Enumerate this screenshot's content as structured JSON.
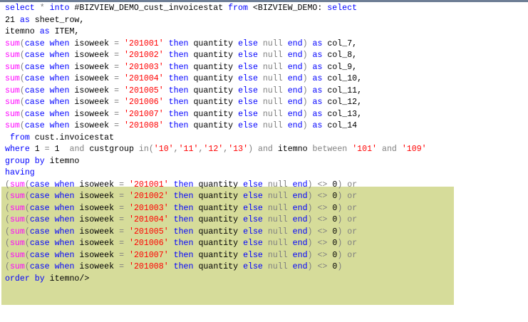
{
  "editor": {
    "lines": [
      [
        [
          "kw",
          "select"
        ],
        [
          "op",
          " * "
        ],
        [
          "kw",
          "into"
        ],
        [
          "plain",
          " #BIZVIEW_DEMO_cust_invoicestat "
        ],
        [
          "kw",
          "from"
        ],
        [
          "plain",
          " <BIZVIEW_DEMO: "
        ],
        [
          "kw",
          "select"
        ]
      ],
      [
        [
          "plain",
          "21 "
        ],
        [
          "kw",
          "as"
        ],
        [
          "plain",
          " sheet_row,"
        ]
      ],
      [
        [
          "plain",
          "itemno "
        ],
        [
          "kw",
          "as"
        ],
        [
          "plain",
          " ITEM,"
        ]
      ],
      [
        [
          "fn",
          "sum"
        ],
        [
          "op",
          "("
        ],
        [
          "kw",
          "case when"
        ],
        [
          "plain",
          " isoweek "
        ],
        [
          "op",
          "="
        ],
        [
          "plain",
          " "
        ],
        [
          "str",
          "'201001'"
        ],
        [
          "plain",
          " "
        ],
        [
          "kw",
          "then"
        ],
        [
          "plain",
          " quantity "
        ],
        [
          "kw",
          "else"
        ],
        [
          "op",
          " null "
        ],
        [
          "kw",
          "end"
        ],
        [
          "op",
          ")"
        ],
        [
          "plain",
          " "
        ],
        [
          "kw",
          "as"
        ],
        [
          "plain",
          " col_7,"
        ]
      ],
      [
        [
          "fn",
          "sum"
        ],
        [
          "op",
          "("
        ],
        [
          "kw",
          "case when"
        ],
        [
          "plain",
          " isoweek "
        ],
        [
          "op",
          "="
        ],
        [
          "plain",
          " "
        ],
        [
          "str",
          "'201002'"
        ],
        [
          "plain",
          " "
        ],
        [
          "kw",
          "then"
        ],
        [
          "plain",
          " quantity "
        ],
        [
          "kw",
          "else"
        ],
        [
          "op",
          " null "
        ],
        [
          "kw",
          "end"
        ],
        [
          "op",
          ")"
        ],
        [
          "plain",
          " "
        ],
        [
          "kw",
          "as"
        ],
        [
          "plain",
          " col_8,"
        ]
      ],
      [
        [
          "fn",
          "sum"
        ],
        [
          "op",
          "("
        ],
        [
          "kw",
          "case when"
        ],
        [
          "plain",
          " isoweek "
        ],
        [
          "op",
          "="
        ],
        [
          "plain",
          " "
        ],
        [
          "str",
          "'201003'"
        ],
        [
          "plain",
          " "
        ],
        [
          "kw",
          "then"
        ],
        [
          "plain",
          " quantity "
        ],
        [
          "kw",
          "else"
        ],
        [
          "op",
          " null "
        ],
        [
          "kw",
          "end"
        ],
        [
          "op",
          ")"
        ],
        [
          "plain",
          " "
        ],
        [
          "kw",
          "as"
        ],
        [
          "plain",
          " col_9,"
        ]
      ],
      [
        [
          "fn",
          "sum"
        ],
        [
          "op",
          "("
        ],
        [
          "kw",
          "case when"
        ],
        [
          "plain",
          " isoweek "
        ],
        [
          "op",
          "="
        ],
        [
          "plain",
          " "
        ],
        [
          "str",
          "'201004'"
        ],
        [
          "plain",
          " "
        ],
        [
          "kw",
          "then"
        ],
        [
          "plain",
          " quantity "
        ],
        [
          "kw",
          "else"
        ],
        [
          "op",
          " null "
        ],
        [
          "kw",
          "end"
        ],
        [
          "op",
          ")"
        ],
        [
          "plain",
          " "
        ],
        [
          "kw",
          "as"
        ],
        [
          "plain",
          " col_10,"
        ]
      ],
      [
        [
          "fn",
          "sum"
        ],
        [
          "op",
          "("
        ],
        [
          "kw",
          "case when"
        ],
        [
          "plain",
          " isoweek "
        ],
        [
          "op",
          "="
        ],
        [
          "plain",
          " "
        ],
        [
          "str",
          "'201005'"
        ],
        [
          "plain",
          " "
        ],
        [
          "kw",
          "then"
        ],
        [
          "plain",
          " quantity "
        ],
        [
          "kw",
          "else"
        ],
        [
          "op",
          " null "
        ],
        [
          "kw",
          "end"
        ],
        [
          "op",
          ")"
        ],
        [
          "plain",
          " "
        ],
        [
          "kw",
          "as"
        ],
        [
          "plain",
          " col_11,"
        ]
      ],
      [
        [
          "fn",
          "sum"
        ],
        [
          "op",
          "("
        ],
        [
          "kw",
          "case when"
        ],
        [
          "plain",
          " isoweek "
        ],
        [
          "op",
          "="
        ],
        [
          "plain",
          " "
        ],
        [
          "str",
          "'201006'"
        ],
        [
          "plain",
          " "
        ],
        [
          "kw",
          "then"
        ],
        [
          "plain",
          " quantity "
        ],
        [
          "kw",
          "else"
        ],
        [
          "op",
          " null "
        ],
        [
          "kw",
          "end"
        ],
        [
          "op",
          ")"
        ],
        [
          "plain",
          " "
        ],
        [
          "kw",
          "as"
        ],
        [
          "plain",
          " col_12,"
        ]
      ],
      [
        [
          "fn",
          "sum"
        ],
        [
          "op",
          "("
        ],
        [
          "kw",
          "case when"
        ],
        [
          "plain",
          " isoweek "
        ],
        [
          "op",
          "="
        ],
        [
          "plain",
          " "
        ],
        [
          "str",
          "'201007'"
        ],
        [
          "plain",
          " "
        ],
        [
          "kw",
          "then"
        ],
        [
          "plain",
          " quantity "
        ],
        [
          "kw",
          "else"
        ],
        [
          "op",
          " null "
        ],
        [
          "kw",
          "end"
        ],
        [
          "op",
          ")"
        ],
        [
          "plain",
          " "
        ],
        [
          "kw",
          "as"
        ],
        [
          "plain",
          " col_13,"
        ]
      ],
      [
        [
          "fn",
          "sum"
        ],
        [
          "op",
          "("
        ],
        [
          "kw",
          "case when"
        ],
        [
          "plain",
          " isoweek "
        ],
        [
          "op",
          "="
        ],
        [
          "plain",
          " "
        ],
        [
          "str",
          "'201008'"
        ],
        [
          "plain",
          " "
        ],
        [
          "kw",
          "then"
        ],
        [
          "plain",
          " quantity "
        ],
        [
          "kw",
          "else"
        ],
        [
          "op",
          " null "
        ],
        [
          "kw",
          "end"
        ],
        [
          "op",
          ")"
        ],
        [
          "plain",
          " "
        ],
        [
          "kw",
          "as"
        ],
        [
          "plain",
          " col_14"
        ]
      ],
      [
        [
          "plain",
          " "
        ],
        [
          "kw",
          "from"
        ],
        [
          "plain",
          " cust.invoicestat"
        ]
      ],
      [
        [
          "kw",
          "where"
        ],
        [
          "plain",
          " 1 "
        ],
        [
          "op",
          "="
        ],
        [
          "plain",
          " 1  "
        ],
        [
          "op",
          "and"
        ],
        [
          "plain",
          " custgroup "
        ],
        [
          "op",
          "in"
        ],
        [
          "op",
          "("
        ],
        [
          "str",
          "'10'"
        ],
        [
          "op",
          ","
        ],
        [
          "str",
          "'11'"
        ],
        [
          "op",
          ","
        ],
        [
          "str",
          "'12'"
        ],
        [
          "op",
          ","
        ],
        [
          "str",
          "'13'"
        ],
        [
          "op",
          ")"
        ],
        [
          "plain",
          " "
        ],
        [
          "op",
          "and"
        ],
        [
          "plain",
          " itemno "
        ],
        [
          "op",
          "between"
        ],
        [
          "plain",
          " "
        ],
        [
          "str",
          "'101'"
        ],
        [
          "plain",
          " "
        ],
        [
          "op",
          "and"
        ],
        [
          "plain",
          " "
        ],
        [
          "str",
          "'109'"
        ]
      ],
      [
        [
          "kw",
          "group by"
        ],
        [
          "plain",
          " itemno"
        ]
      ],
      [
        [
          "kw",
          "having"
        ]
      ],
      [
        [
          "op",
          "("
        ],
        [
          "fn",
          "sum"
        ],
        [
          "op",
          "("
        ],
        [
          "kw",
          "case when"
        ],
        [
          "plain",
          " isoweek "
        ],
        [
          "op",
          "="
        ],
        [
          "plain",
          " "
        ],
        [
          "str",
          "'201001'"
        ],
        [
          "plain",
          " "
        ],
        [
          "kw",
          "then"
        ],
        [
          "plain",
          " quantity "
        ],
        [
          "kw",
          "else"
        ],
        [
          "op",
          " null "
        ],
        [
          "kw",
          "end"
        ],
        [
          "op",
          ")"
        ],
        [
          "plain",
          " "
        ],
        [
          "op",
          "<>"
        ],
        [
          "plain",
          " 0"
        ],
        [
          "op",
          ")"
        ],
        [
          "plain",
          " "
        ],
        [
          "op",
          "or"
        ]
      ],
      [
        [
          "op",
          "("
        ],
        [
          "fn",
          "sum"
        ],
        [
          "op",
          "("
        ],
        [
          "kw",
          "case when"
        ],
        [
          "plain",
          " isoweek "
        ],
        [
          "op",
          "="
        ],
        [
          "plain",
          " "
        ],
        [
          "str",
          "'201002'"
        ],
        [
          "plain",
          " "
        ],
        [
          "kw",
          "then"
        ],
        [
          "plain",
          " quantity "
        ],
        [
          "kw",
          "else"
        ],
        [
          "op",
          " null "
        ],
        [
          "kw",
          "end"
        ],
        [
          "op",
          ")"
        ],
        [
          "plain",
          " "
        ],
        [
          "op",
          "<>"
        ],
        [
          "plain",
          " 0"
        ],
        [
          "op",
          ")"
        ],
        [
          "plain",
          " "
        ],
        [
          "op",
          "or"
        ]
      ],
      [
        [
          "op",
          "("
        ],
        [
          "fn",
          "sum"
        ],
        [
          "op",
          "("
        ],
        [
          "kw",
          "case when"
        ],
        [
          "plain",
          " isoweek "
        ],
        [
          "op",
          "="
        ],
        [
          "plain",
          " "
        ],
        [
          "str",
          "'201003'"
        ],
        [
          "plain",
          " "
        ],
        [
          "kw",
          "then"
        ],
        [
          "plain",
          " quantity "
        ],
        [
          "kw",
          "else"
        ],
        [
          "op",
          " null "
        ],
        [
          "kw",
          "end"
        ],
        [
          "op",
          ")"
        ],
        [
          "plain",
          " "
        ],
        [
          "op",
          "<>"
        ],
        [
          "plain",
          " 0"
        ],
        [
          "op",
          ")"
        ],
        [
          "plain",
          " "
        ],
        [
          "op",
          "or"
        ]
      ],
      [
        [
          "op",
          "("
        ],
        [
          "fn",
          "sum"
        ],
        [
          "op",
          "("
        ],
        [
          "kw",
          "case when"
        ],
        [
          "plain",
          " isoweek "
        ],
        [
          "op",
          "="
        ],
        [
          "plain",
          " "
        ],
        [
          "str",
          "'201004'"
        ],
        [
          "plain",
          " "
        ],
        [
          "kw",
          "then"
        ],
        [
          "plain",
          " quantity "
        ],
        [
          "kw",
          "else"
        ],
        [
          "op",
          " null "
        ],
        [
          "kw",
          "end"
        ],
        [
          "op",
          ")"
        ],
        [
          "plain",
          " "
        ],
        [
          "op",
          "<>"
        ],
        [
          "plain",
          " 0"
        ],
        [
          "op",
          ")"
        ],
        [
          "plain",
          " "
        ],
        [
          "op",
          "or"
        ]
      ],
      [
        [
          "op",
          "("
        ],
        [
          "fn",
          "sum"
        ],
        [
          "op",
          "("
        ],
        [
          "kw",
          "case when"
        ],
        [
          "plain",
          " isoweek "
        ],
        [
          "op",
          "="
        ],
        [
          "plain",
          " "
        ],
        [
          "str",
          "'201005'"
        ],
        [
          "plain",
          " "
        ],
        [
          "kw",
          "then"
        ],
        [
          "plain",
          " quantity "
        ],
        [
          "kw",
          "else"
        ],
        [
          "op",
          " null "
        ],
        [
          "kw",
          "end"
        ],
        [
          "op",
          ")"
        ],
        [
          "plain",
          " "
        ],
        [
          "op",
          "<>"
        ],
        [
          "plain",
          " 0"
        ],
        [
          "op",
          ")"
        ],
        [
          "plain",
          " "
        ],
        [
          "op",
          "or"
        ]
      ],
      [
        [
          "op",
          "("
        ],
        [
          "fn",
          "sum"
        ],
        [
          "op",
          "("
        ],
        [
          "kw",
          "case when"
        ],
        [
          "plain",
          " isoweek "
        ],
        [
          "op",
          "="
        ],
        [
          "plain",
          " "
        ],
        [
          "str",
          "'201006'"
        ],
        [
          "plain",
          " "
        ],
        [
          "kw",
          "then"
        ],
        [
          "plain",
          " quantity "
        ],
        [
          "kw",
          "else"
        ],
        [
          "op",
          " null "
        ],
        [
          "kw",
          "end"
        ],
        [
          "op",
          ")"
        ],
        [
          "plain",
          " "
        ],
        [
          "op",
          "<>"
        ],
        [
          "plain",
          " 0"
        ],
        [
          "op",
          ")"
        ],
        [
          "plain",
          " "
        ],
        [
          "op",
          "or"
        ]
      ],
      [
        [
          "op",
          "("
        ],
        [
          "fn",
          "sum"
        ],
        [
          "op",
          "("
        ],
        [
          "kw",
          "case when"
        ],
        [
          "plain",
          " isoweek "
        ],
        [
          "op",
          "="
        ],
        [
          "plain",
          " "
        ],
        [
          "str",
          "'201007'"
        ],
        [
          "plain",
          " "
        ],
        [
          "kw",
          "then"
        ],
        [
          "plain",
          " quantity "
        ],
        [
          "kw",
          "else"
        ],
        [
          "op",
          " null "
        ],
        [
          "kw",
          "end"
        ],
        [
          "op",
          ")"
        ],
        [
          "plain",
          " "
        ],
        [
          "op",
          "<>"
        ],
        [
          "plain",
          " 0"
        ],
        [
          "op",
          ")"
        ],
        [
          "plain",
          " "
        ],
        [
          "op",
          "or"
        ]
      ],
      [
        [
          "op",
          "("
        ],
        [
          "fn",
          "sum"
        ],
        [
          "op",
          "("
        ],
        [
          "kw",
          "case when"
        ],
        [
          "plain",
          " isoweek "
        ],
        [
          "op",
          "="
        ],
        [
          "plain",
          " "
        ],
        [
          "str",
          "'201008'"
        ],
        [
          "plain",
          " "
        ],
        [
          "kw",
          "then"
        ],
        [
          "plain",
          " quantity "
        ],
        [
          "kw",
          "else"
        ],
        [
          "op",
          " null "
        ],
        [
          "kw",
          "end"
        ],
        [
          "op",
          ")"
        ],
        [
          "plain",
          " "
        ],
        [
          "op",
          "<>"
        ],
        [
          "plain",
          " 0"
        ],
        [
          "op",
          ")"
        ]
      ],
      [
        [
          "kw",
          "order by"
        ],
        [
          "plain",
          " itemno/>"
        ]
      ]
    ]
  },
  "colors": {
    "keyword": "#0000ff",
    "function": "#ff00ff",
    "string": "#ff0000",
    "operator": "#808080",
    "highlight": "#d6dc9a"
  }
}
